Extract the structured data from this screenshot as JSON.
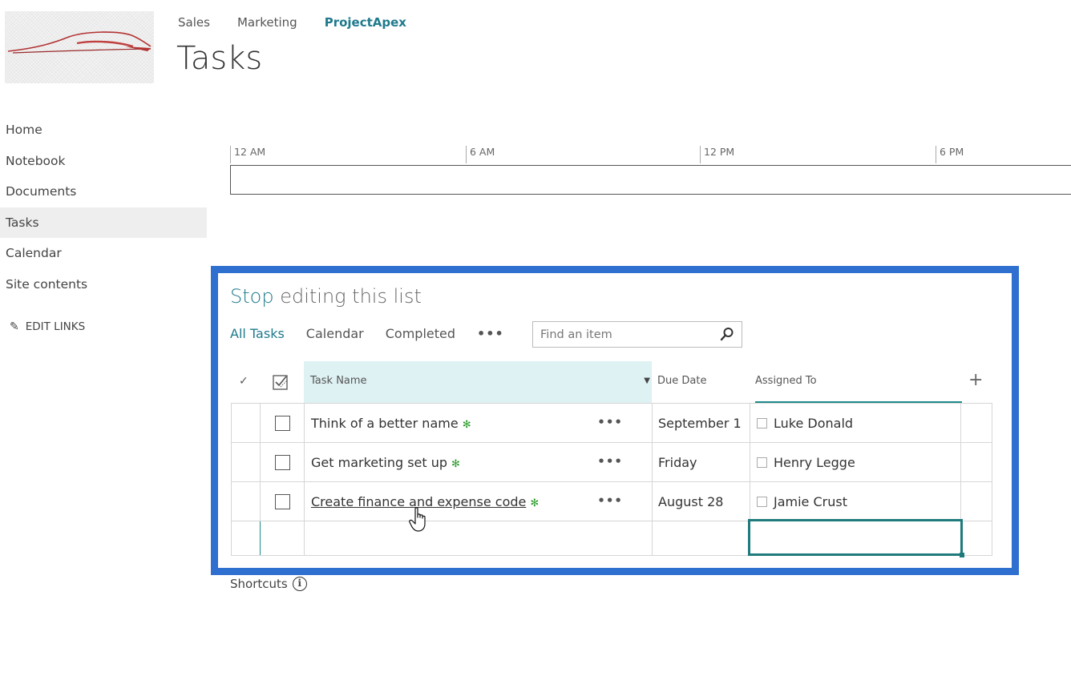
{
  "top_nav": [
    "Sales",
    "Marketing",
    "ProjectApex"
  ],
  "page_title": "Tasks",
  "left_nav": {
    "items": [
      "Home",
      "Notebook",
      "Documents",
      "Tasks",
      "Calendar",
      "Site contents"
    ],
    "active": "Tasks",
    "edit_links": "EDIT LINKS"
  },
  "timeline": {
    "labels": [
      "12 AM",
      "6 AM",
      "12 PM",
      "6 PM"
    ]
  },
  "edit_mode": {
    "stop_word": "Stop",
    "rest": " editing this list"
  },
  "views": {
    "items": [
      "All Tasks",
      "Calendar",
      "Completed"
    ],
    "active": "All Tasks",
    "more": "•••",
    "search_placeholder": "Find an item"
  },
  "grid": {
    "columns": {
      "task_name": "Task Name",
      "due_date": "Due Date",
      "assigned_to": "Assigned To"
    },
    "check_glyph": "✓",
    "add_column": "+",
    "rows": [
      {
        "task": "Think of a better name",
        "due": "September 1",
        "assigned": "Luke Donald",
        "new_badge": "✻"
      },
      {
        "task": "Get marketing set up",
        "due": "Friday",
        "assigned": "Henry Legge",
        "new_badge": "✻"
      },
      {
        "task": "Create finance and expense code",
        "due": "August 28",
        "assigned": "Jamie Crust",
        "new_badge": "✻"
      }
    ],
    "row_menu": "•••"
  },
  "shortcuts": {
    "label": "Shortcuts",
    "info_glyph": "i"
  },
  "colors": {
    "accent": "#1f7a8c",
    "highlight_frame": "#2f6fcf",
    "header_bg": "#def1f3",
    "new_badge": "#2e9c2e"
  }
}
